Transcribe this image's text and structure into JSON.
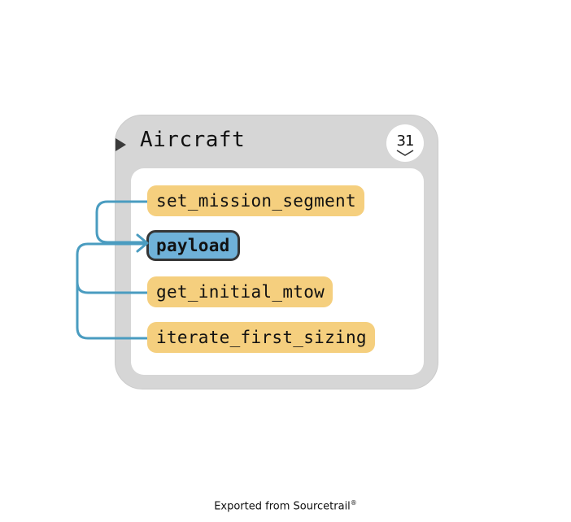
{
  "class_node": {
    "title": "Aircraft",
    "member_count": "31",
    "icons": {
      "expand": "triangle-right-icon",
      "collapse": "chevron-down-icon"
    }
  },
  "members": [
    {
      "label": "set_mission_segment",
      "active": false
    },
    {
      "label": "payload",
      "active": true
    },
    {
      "label": "get_initial_mtow",
      "active": false
    },
    {
      "label": "iterate_first_sizing",
      "active": false
    }
  ],
  "edges": [
    {
      "from": "set_mission_segment",
      "to": "payload"
    },
    {
      "from": "get_initial_mtow",
      "to": "payload"
    },
    {
      "from": "iterate_first_sizing",
      "to": "payload"
    }
  ],
  "footer": {
    "text": "Exported from Sourcetrail",
    "mark": "®"
  },
  "colors": {
    "member_fill": "#f5cf7e",
    "active_fill": "#6fb1d8",
    "active_border": "#353535",
    "edge": "#4a9cc0",
    "class_fill": "#d6d6d6"
  }
}
